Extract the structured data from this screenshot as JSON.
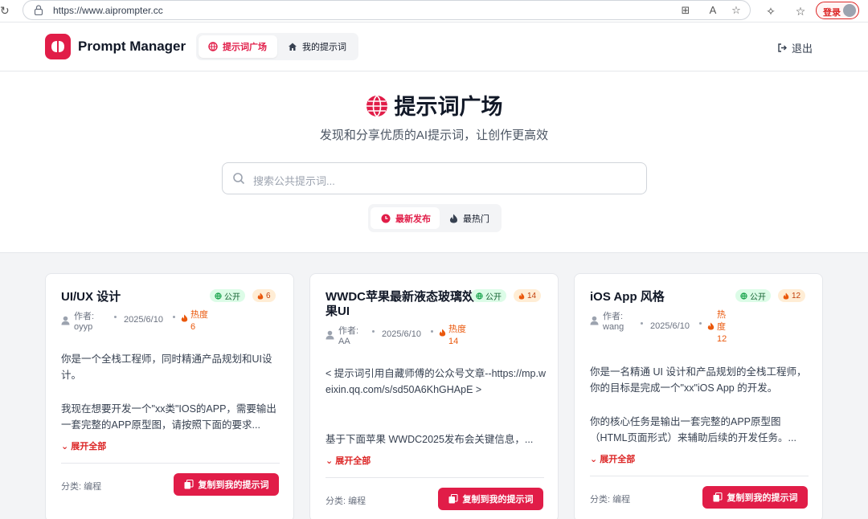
{
  "browser": {
    "url": "https://www.aiprompter.cc",
    "login_label": "登录"
  },
  "nav": {
    "brand": "Prompt Manager",
    "tabs": [
      {
        "label": "提示词广场",
        "icon": "globe-icon",
        "active": true
      },
      {
        "label": "我的提示词",
        "icon": "home-icon",
        "active": false
      }
    ],
    "logout_label": "退出"
  },
  "hero": {
    "title": "提示词广场",
    "subtitle": "发现和分享优质的AI提示词，让创作更高效",
    "search_placeholder": "搜索公共提示词...",
    "sort_tabs": [
      {
        "label": "最新发布",
        "icon": "clock-icon",
        "active": true
      },
      {
        "label": "最热门",
        "icon": "flame-icon",
        "active": false
      }
    ]
  },
  "cards": [
    {
      "title": "UI/UX 设计",
      "visibility": "公开",
      "hot": "6",
      "author_label": "作者:",
      "author": "oyyp",
      "date": "2025/6/10",
      "heat_label": "热度",
      "heat_value": "6",
      "content_p1": "你是一个全栈工程师，同时精通产品规划和UI设计。",
      "content_p2": "我现在想要开发一个\"xx类\"IOS的APP，需要输出一套完整的APP原型图，请按照下面的要求...",
      "expand_label": "展开全部",
      "category": "分类: 编程",
      "copy_label": "复制到我的提示词"
    },
    {
      "title": "WWDC苹果最新液态玻璃效果UI",
      "visibility": "公开",
      "hot": "14",
      "author_label": "作者:",
      "author": "AA",
      "date": "2025/6/10",
      "heat_label": "热度",
      "heat_value": "14",
      "content_p1": "< 提示词引用自藏师傅的公众号文章--https://mp.weixin.qq.com/s/sd50A6KhGHApE >",
      "content_p2": "基于下面苹果 WWDC2025发布会关键信息，...",
      "expand_label": "展开全部",
      "category": "分类: 编程",
      "copy_label": "复制到我的提示词"
    },
    {
      "title": "iOS App 风格",
      "visibility": "公开",
      "hot": "12",
      "author_label": "作者:",
      "author": "wang",
      "date": "2025/6/10",
      "heat_label": "热度",
      "heat_value": "12",
      "content_p1": "你是一名精通 UI 设计和产品规划的全栈工程师，你的目标是完成一个\"xx\"iOS App 的开发。",
      "content_p2": "你的核心任务是输出一套完整的APP原型图（HTML页面形式）来辅助后续的开发任务。...",
      "expand_label": "展开全部",
      "category": "分类: 编程",
      "copy_label": "复制到我的提示词"
    }
  ]
}
